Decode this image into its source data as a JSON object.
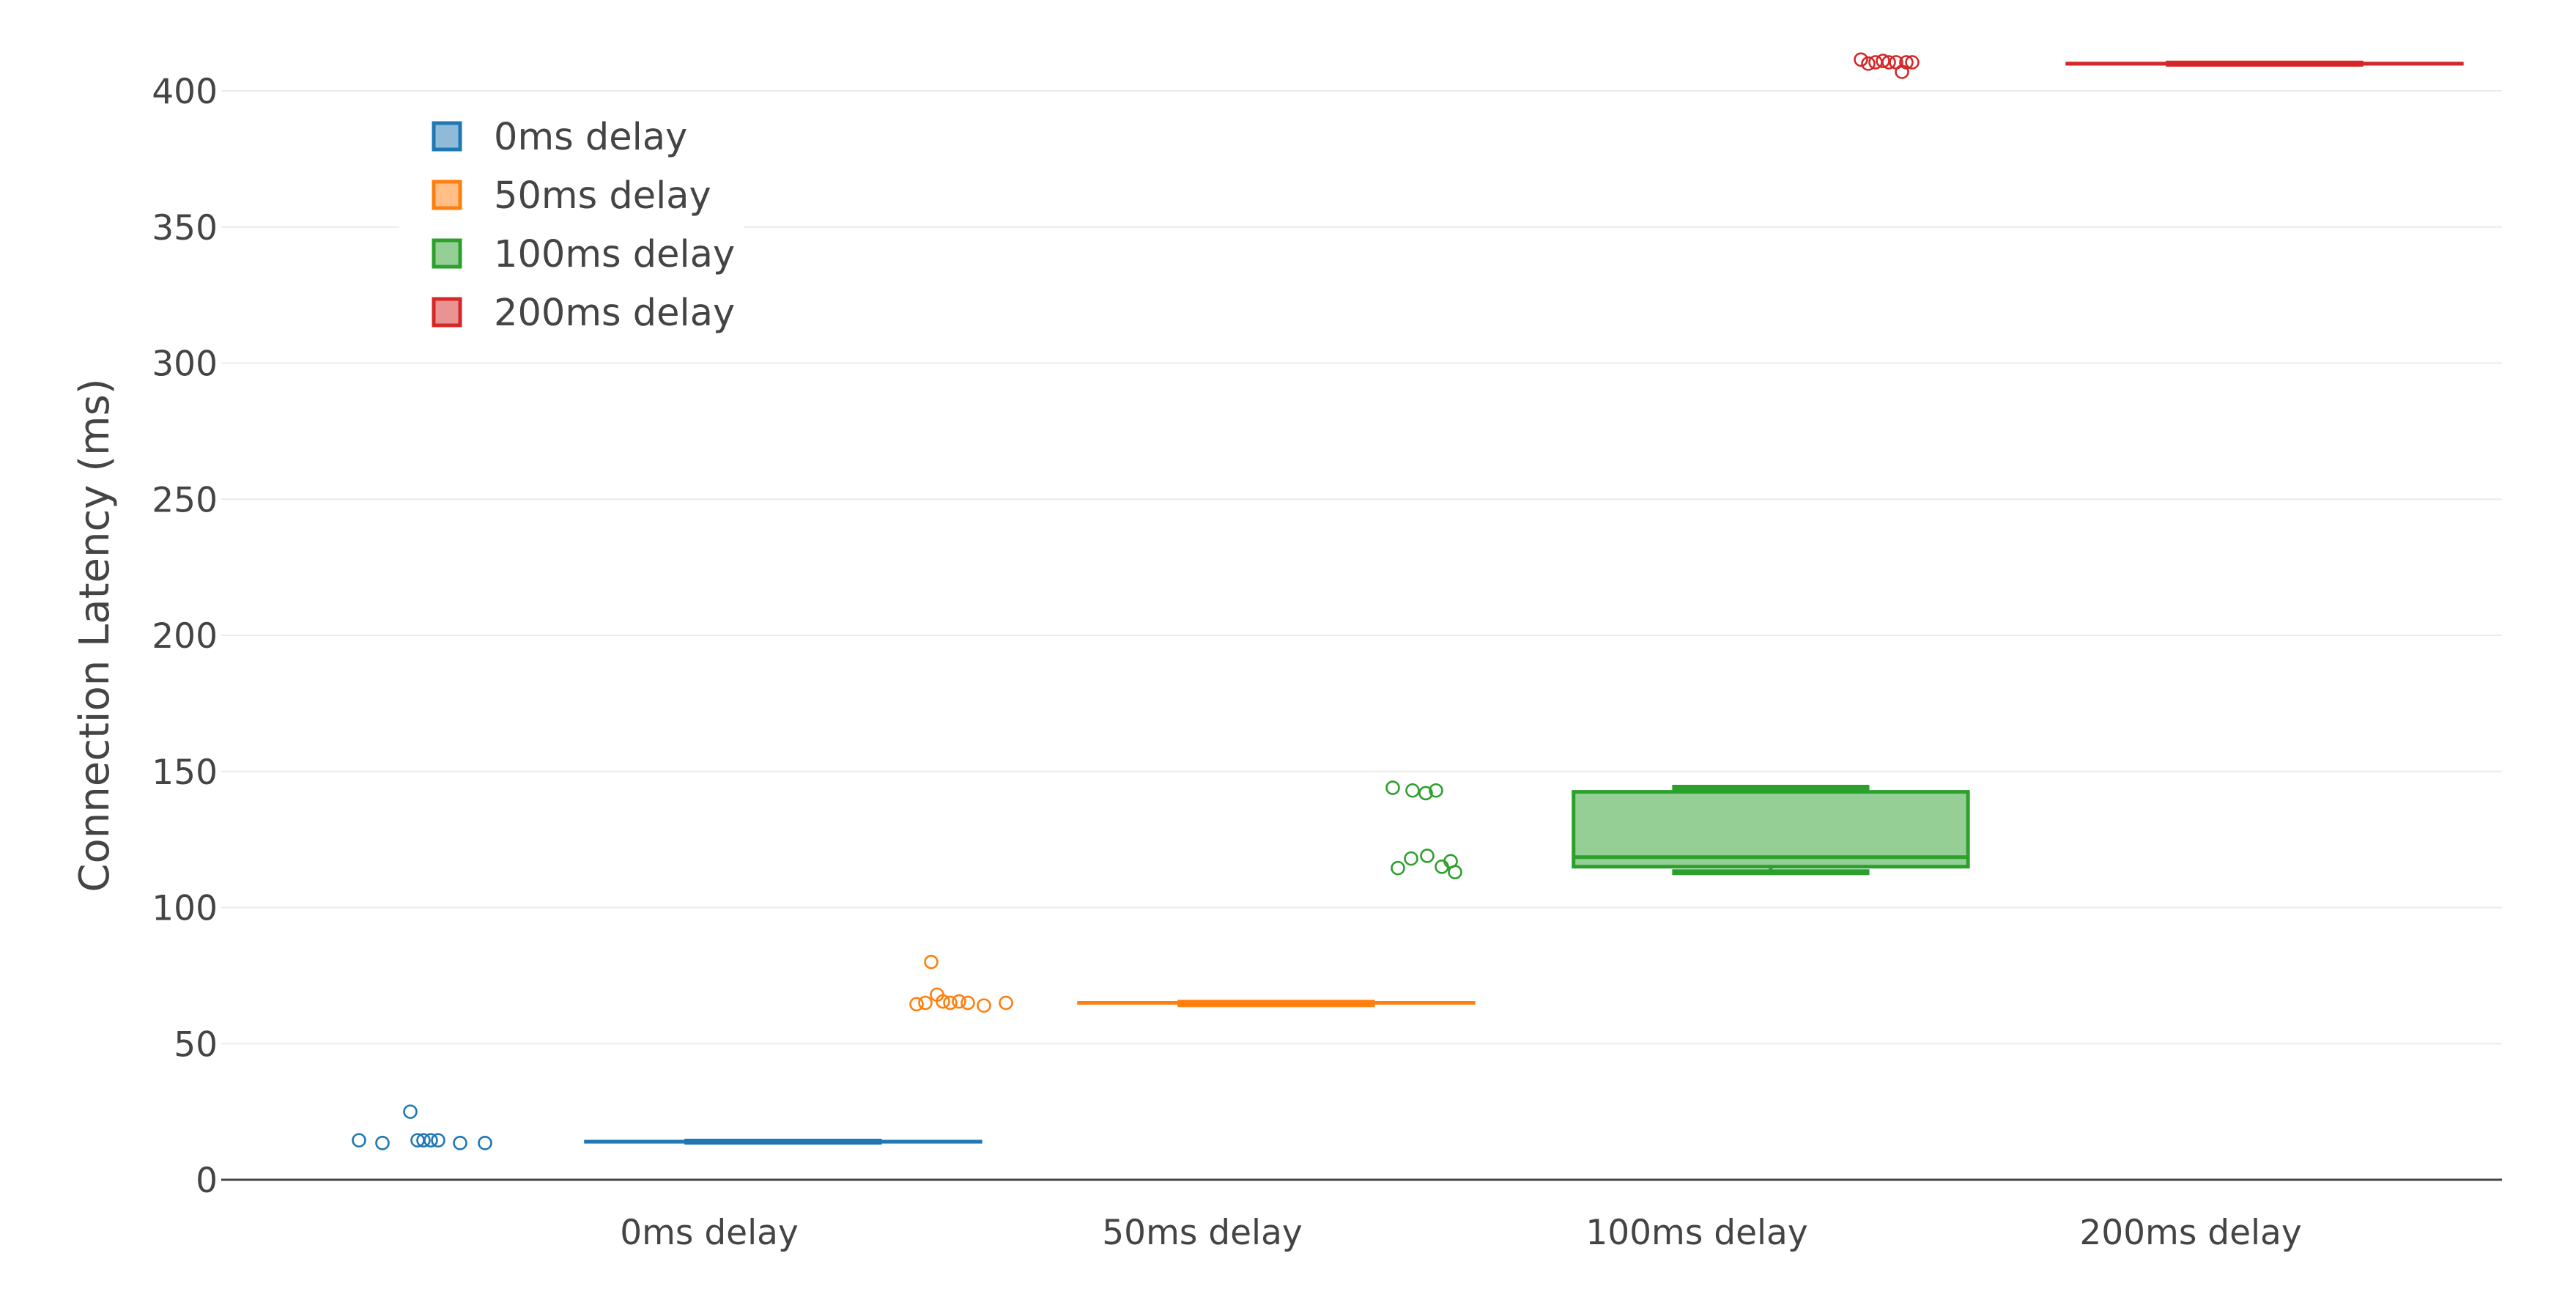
{
  "chart_data": {
    "type": "box",
    "title": "",
    "xlabel": "",
    "ylabel": "Connection Latency (ms)",
    "ylim": [
      0,
      400
    ],
    "yticks": [
      0,
      50,
      100,
      150,
      200,
      250,
      300,
      350,
      400
    ],
    "categories": [
      "0ms delay",
      "50ms delay",
      "100ms delay",
      "200ms delay"
    ],
    "grid": true,
    "legend_position": "top-left",
    "boxpoints": "all",
    "series": [
      {
        "name": "0ms delay",
        "color": "#1f77b4",
        "box": {
          "q1": 14,
          "median": 14,
          "q3": 14,
          "whisker_low": 14,
          "whisker_high": 14
        },
        "points": [
          14.5,
          13.5,
          25,
          14.5,
          14.5,
          14.5,
          14.5,
          13.5,
          13.5
        ]
      },
      {
        "name": "50ms delay",
        "color": "#ff7f0e",
        "box": {
          "q1": 65,
          "median": 65,
          "q3": 65,
          "whisker_low": 64.5,
          "whisker_high": 65
        },
        "points": [
          64.5,
          65,
          80,
          68,
          65.5,
          65,
          65.5,
          65,
          64,
          65
        ]
      },
      {
        "name": "100ms delay",
        "color": "#2ca02c",
        "box": {
          "q1": 115,
          "median": 118.5,
          "q3": 142.5,
          "whisker_low": 113,
          "whisker_high": 144
        },
        "points": [
          144,
          143,
          142,
          143,
          117,
          114.5,
          118,
          119,
          115,
          113
        ]
      },
      {
        "name": "200ms delay",
        "color": "#d62728",
        "box": {
          "q1": 410,
          "median": 410,
          "q3": 410,
          "whisker_low": 410,
          "whisker_high": 410
        },
        "points": [
          411.5,
          410,
          410.5,
          411,
          410.5,
          410.5,
          407,
          410.5,
          410.5
        ]
      }
    ]
  }
}
